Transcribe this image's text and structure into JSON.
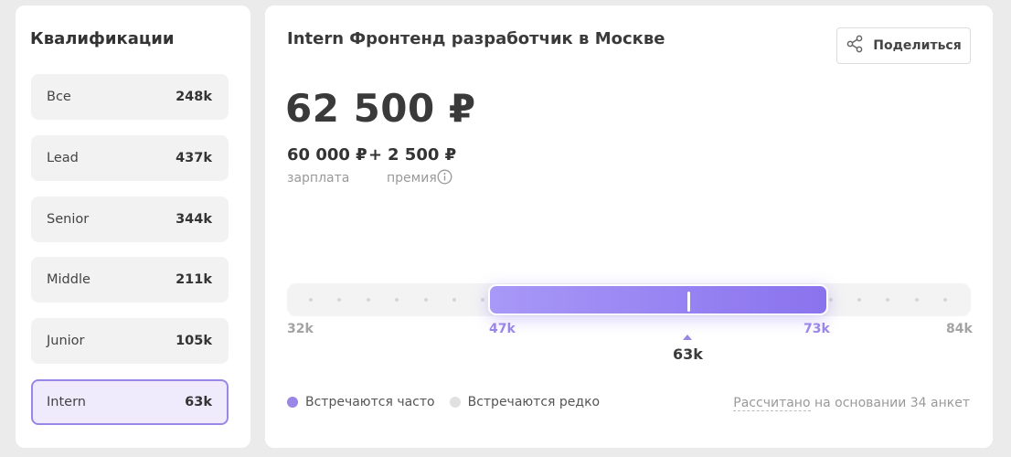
{
  "sidebar": {
    "title": "Квалификации",
    "items": [
      {
        "label": "Все",
        "value": "248k"
      },
      {
        "label": "Lead",
        "value": "437k"
      },
      {
        "label": "Senior",
        "value": "344k"
      },
      {
        "label": "Middle",
        "value": "211k"
      },
      {
        "label": "Junior",
        "value": "105k"
      },
      {
        "label": "Intern",
        "value": "63k",
        "selected": true
      }
    ]
  },
  "main": {
    "title": "Intern Фронтенд разработчик в Москве",
    "share_label": "Поделиться",
    "total": "62 500 ₽",
    "salary": {
      "value": "60 000 ₽",
      "label": "зарплата"
    },
    "plus": "+",
    "bonus": {
      "value": "2 500 ₽",
      "label": "премия"
    },
    "range": {
      "min_label": "32k",
      "low_label": "47k",
      "high_label": "73k",
      "max_label": "84k",
      "median_label": "63k",
      "min": 32,
      "low": 47,
      "high": 73,
      "max": 84,
      "median": 63
    },
    "legend": {
      "frequent": "Встречаются часто",
      "rare": "Встречаются редко"
    },
    "calc_link": "Рассчитано",
    "calc_rest": " на основании 34 анкет"
  },
  "colors": {
    "accent": "#9a86e6",
    "range_start": "#a898f7",
    "range_end": "#8a73ee",
    "rare_dot": "#e0e0e0",
    "active_bg": "#efebfc"
  },
  "icons": {
    "share": "share-icon",
    "info": "info-icon"
  }
}
